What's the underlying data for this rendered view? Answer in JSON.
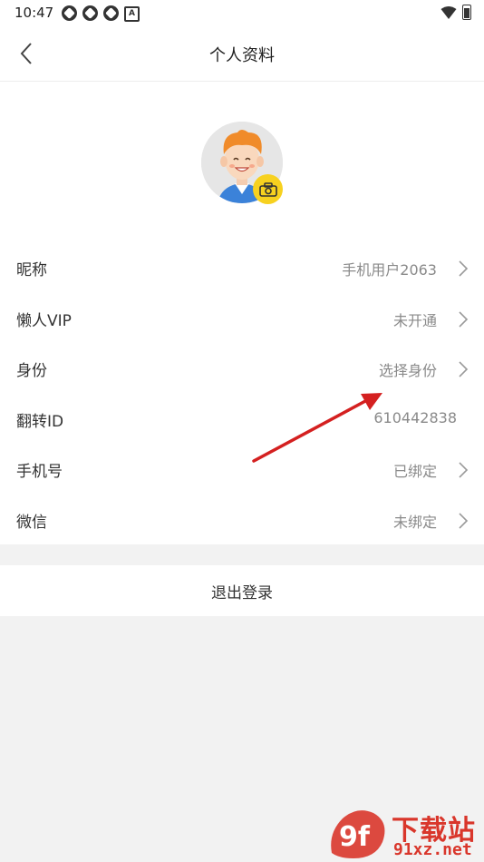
{
  "status_bar": {
    "time": "10:47",
    "notification_icons": [
      "app-icon",
      "app-icon",
      "app-icon",
      "a-icon"
    ],
    "right_icons": [
      "wifi-icon",
      "battery-icon"
    ]
  },
  "header": {
    "title": "个人资料",
    "back_icon": "chevron-left-icon"
  },
  "avatar": {
    "badge_icon": "camera-icon"
  },
  "rows": [
    {
      "label": "昵称",
      "value": "手机用户2063",
      "arrow": true
    },
    {
      "label": "懒人VIP",
      "value": "未开通",
      "arrow": true
    },
    {
      "label": "身份",
      "value": "选择身份",
      "arrow": true
    },
    {
      "label": "翻转ID",
      "value": "610442838",
      "arrow": false
    },
    {
      "label": "手机号",
      "value": "已绑定",
      "arrow": true
    },
    {
      "label": "微信",
      "value": "未绑定",
      "arrow": true
    }
  ],
  "logout": {
    "label": "退出登录"
  },
  "watermark": {
    "logo_text": "9f",
    "title": "下载站",
    "url": "91xz.net"
  },
  "colors": {
    "accent_badge": "#f7d11f",
    "annotation_arrow": "#d42020",
    "watermark": "#d9362b"
  }
}
